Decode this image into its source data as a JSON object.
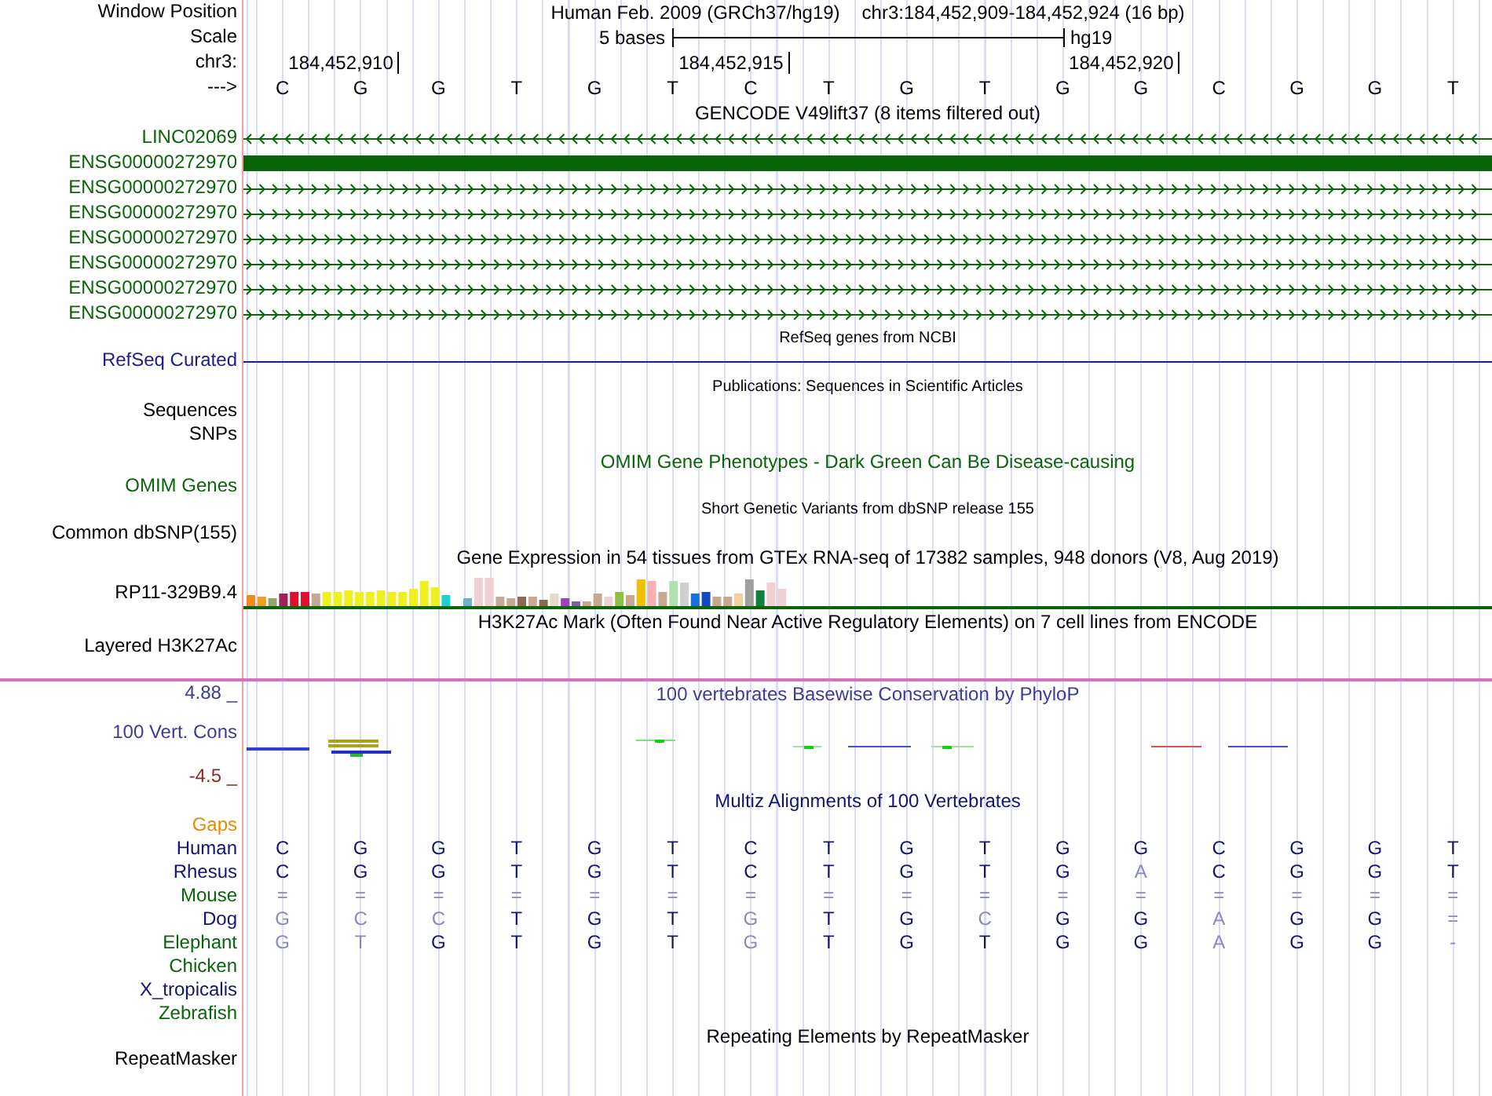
{
  "position_bar": {
    "label": "Window Position",
    "assembly": "Human Feb. 2009 (GRCh37/hg19)",
    "range": "chr3:184,452,909-184,452,924 (16 bp)"
  },
  "scale": {
    "label": "Scale",
    "span": "5 bases",
    "assembly": "hg19"
  },
  "ruler": {
    "label": "chr3:",
    "ticks": [
      "184,452,910",
      "184,452,915",
      "184,452,920"
    ]
  },
  "sequence": {
    "label": "--->",
    "bases": [
      "C",
      "G",
      "G",
      "T",
      "G",
      "T",
      "C",
      "T",
      "G",
      "T",
      "G",
      "G",
      "C",
      "G",
      "G",
      "T"
    ]
  },
  "tracks": [
    {
      "kind": "genes",
      "title": {
        "text": "GENCODE V49lift37 (8 items filtered out)",
        "color": "#000000"
      },
      "color": "#0a640a",
      "items": [
        {
          "name": "LINC02069",
          "kind": "minus"
        },
        {
          "name": "ENSG00000272970",
          "kind": "exon"
        },
        {
          "name": "ENSG00000272970",
          "kind": "plus"
        },
        {
          "name": "ENSG00000272970",
          "kind": "plus"
        },
        {
          "name": "ENSG00000272970",
          "kind": "plus"
        },
        {
          "name": "ENSG00000272970",
          "kind": "plus"
        },
        {
          "name": "ENSG00000272970",
          "kind": "plus"
        },
        {
          "name": "ENSG00000272970",
          "kind": "plus"
        }
      ]
    },
    {
      "kind": "line",
      "title": {
        "text": "RefSeq genes from NCBI",
        "color": "#000000"
      },
      "label": "RefSeq Curated",
      "color": "#1c1c8c"
    },
    {
      "kind": "labels",
      "title": {
        "text": "Publications: Sequences in Scientific Articles",
        "color": "#000000"
      },
      "labels": [
        "Sequences",
        "SNPs"
      ],
      "color": "#000000"
    },
    {
      "kind": "labels",
      "title": {
        "text": "OMIM Gene Phenotypes - Dark Green Can Be Disease-causing",
        "color": "#0a640a"
      },
      "labels": [
        "OMIM Genes"
      ],
      "color": "#0a640a"
    },
    {
      "kind": "labels",
      "title": {
        "text": "Short Genetic Variants from dbSNP release 155",
        "color": "#000000"
      },
      "labels": [
        "Common dbSNP(155)"
      ],
      "color": "#000000"
    },
    {
      "kind": "expression",
      "title": {
        "text": "Gene Expression in 54 tissues from GTEx RNA-seq of 17382 samples, 948 donors (V8, Aug 2019)",
        "color": "#000000"
      },
      "label": "RP11-329B9.4",
      "color": "#000000"
    },
    {
      "kind": "labels",
      "title": {
        "text": "H3K27Ac Mark (Often Found Near Active Regulatory Elements) on 7 cell lines from ENCODE",
        "color": "#000000"
      },
      "labels": [
        "Layered H3K27Ac"
      ],
      "color": "#000000"
    },
    {
      "kind": "wiggle",
      "title": {
        "text": "100 vertebrates Basewise Conservation by PhyloP",
        "color": "#3c3c96"
      },
      "label": "100 Vert. Cons",
      "color": "#3c3c96",
      "max": "4.88 _",
      "min": "-4.5 _"
    },
    {
      "kind": "alignment",
      "title": {
        "text": "Multiz Alignments of 100 Vertebrates",
        "color": "#14146e"
      },
      "gaps": {
        "label": "Gaps",
        "color": "#e68a00"
      },
      "species": [
        {
          "name": "Human",
          "color": "#14146e",
          "bases": [
            {
              "base": "C",
              "match": true
            },
            {
              "base": "G",
              "match": true
            },
            {
              "base": "G",
              "match": true
            },
            {
              "base": "T",
              "match": true
            },
            {
              "base": "G",
              "match": true
            },
            {
              "base": "T",
              "match": true
            },
            {
              "base": "C",
              "match": true
            },
            {
              "base": "T",
              "match": true
            },
            {
              "base": "G",
              "match": true
            },
            {
              "base": "T",
              "match": true
            },
            {
              "base": "G",
              "match": true
            },
            {
              "base": "G",
              "match": true
            },
            {
              "base": "C",
              "match": true
            },
            {
              "base": "G",
              "match": true
            },
            {
              "base": "G",
              "match": true
            },
            {
              "base": "T",
              "match": true
            }
          ]
        },
        {
          "name": "Rhesus",
          "color": "#14146e",
          "bases": [
            {
              "base": "C",
              "match": true
            },
            {
              "base": "G",
              "match": true
            },
            {
              "base": "G",
              "match": true
            },
            {
              "base": "T",
              "match": true
            },
            {
              "base": "G",
              "match": true
            },
            {
              "base": "T",
              "match": true
            },
            {
              "base": "C",
              "match": true
            },
            {
              "base": "T",
              "match": true
            },
            {
              "base": "G",
              "match": true
            },
            {
              "base": "T",
              "match": true
            },
            {
              "base": "G",
              "match": true
            },
            {
              "base": "A",
              "match": false
            },
            {
              "base": "C",
              "match": true
            },
            {
              "base": "G",
              "match": true
            },
            {
              "base": "G",
              "match": true
            },
            {
              "base": "T",
              "match": true
            }
          ]
        },
        {
          "name": "Mouse",
          "color": "#0a640a",
          "bases": [
            {
              "base": "=",
              "match": false
            },
            {
              "base": "=",
              "match": false
            },
            {
              "base": "=",
              "match": false
            },
            {
              "base": "=",
              "match": false
            },
            {
              "base": "=",
              "match": false
            },
            {
              "base": "=",
              "match": false
            },
            {
              "base": "=",
              "match": false
            },
            {
              "base": "=",
              "match": false
            },
            {
              "base": "=",
              "match": false
            },
            {
              "base": "=",
              "match": false
            },
            {
              "base": "=",
              "match": false
            },
            {
              "base": "=",
              "match": false
            },
            {
              "base": "=",
              "match": false
            },
            {
              "base": "=",
              "match": false
            },
            {
              "base": "=",
              "match": false
            },
            {
              "base": "=",
              "match": false
            }
          ]
        },
        {
          "name": "Dog",
          "color": "#14146e",
          "bases": [
            {
              "base": "G",
              "match": false
            },
            {
              "base": "C",
              "match": false
            },
            {
              "base": "C",
              "match": false
            },
            {
              "base": "T",
              "match": true
            },
            {
              "base": "G",
              "match": true
            },
            {
              "base": "T",
              "match": true
            },
            {
              "base": "G",
              "match": false
            },
            {
              "base": "T",
              "match": true
            },
            {
              "base": "G",
              "match": true
            },
            {
              "base": "C",
              "match": false
            },
            {
              "base": "G",
              "match": true
            },
            {
              "base": "G",
              "match": true
            },
            {
              "base": "A",
              "match": false
            },
            {
              "base": "G",
              "match": true
            },
            {
              "base": "G",
              "match": true
            },
            {
              "base": "=",
              "match": false
            }
          ]
        },
        {
          "name": "Elephant",
          "color": "#0a640a",
          "bases": [
            {
              "base": "G",
              "match": false
            },
            {
              "base": "T",
              "match": false
            },
            {
              "base": "G",
              "match": true
            },
            {
              "base": "T",
              "match": true
            },
            {
              "base": "G",
              "match": true
            },
            {
              "base": "T",
              "match": true
            },
            {
              "base": "G",
              "match": false
            },
            {
              "base": "T",
              "match": true
            },
            {
              "base": "G",
              "match": true
            },
            {
              "base": "T",
              "match": true
            },
            {
              "base": "G",
              "match": true
            },
            {
              "base": "G",
              "match": true
            },
            {
              "base": "A",
              "match": false
            },
            {
              "base": "G",
              "match": true
            },
            {
              "base": "G",
              "match": true
            },
            {
              "base": "-",
              "match": false
            }
          ]
        },
        {
          "name": "Chicken",
          "color": "#0a640a"
        },
        {
          "name": "X_tropicalis",
          "color": "#14146e"
        },
        {
          "name": "Zebrafish",
          "color": "#0a640a"
        }
      ]
    },
    {
      "kind": "labels",
      "title": {
        "text": "Repeating Elements by RepeatMasker",
        "color": "#000000"
      },
      "labels": [
        "RepeatMasker"
      ],
      "color": "#000000"
    }
  ]
}
